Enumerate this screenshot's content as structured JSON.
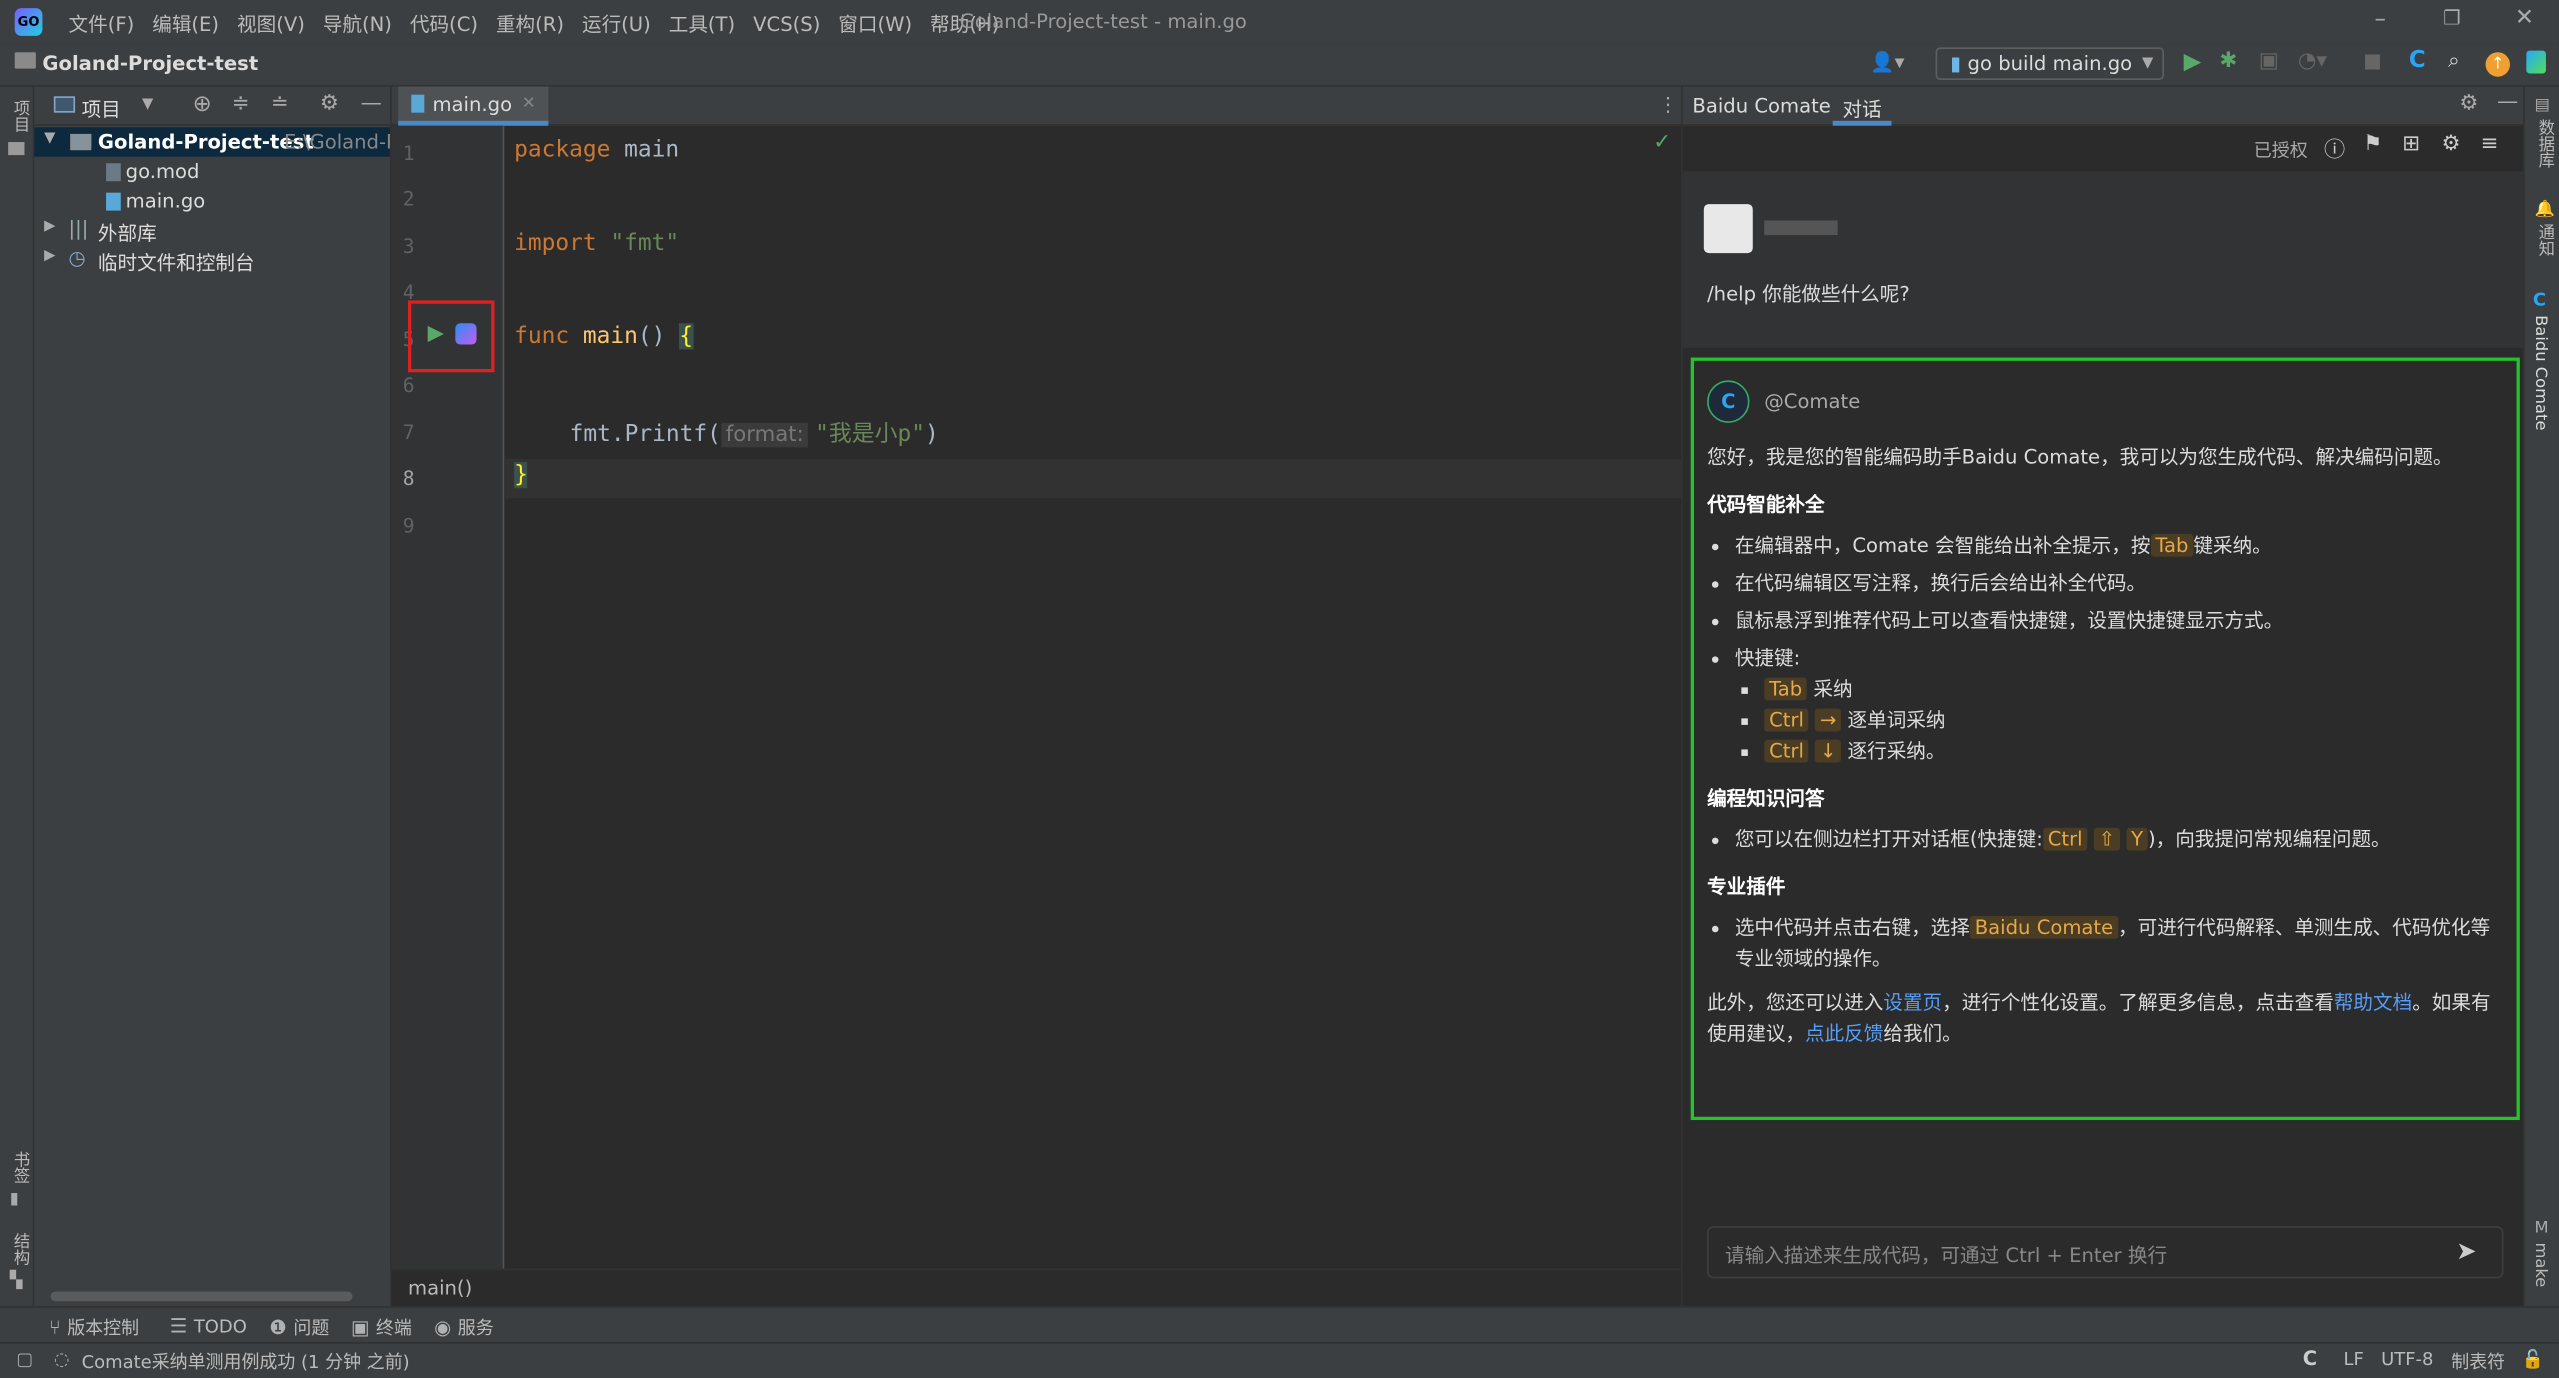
{
  "title_bar": {
    "menus": [
      "文件(F)",
      "编辑(E)",
      "视图(V)",
      "导航(N)",
      "代码(C)",
      "重构(R)",
      "运行(U)",
      "工具(T)",
      "VCS(S)",
      "窗口(W)",
      "帮助(H)"
    ],
    "window_title": "Goland-Project-test - main.go"
  },
  "nav_bar": {
    "project_name": "Goland-Project-test",
    "run_config": "go build main.go"
  },
  "left_strip": {
    "project_label": "项目",
    "bookmarks_label": "书签",
    "structure_label": "结构"
  },
  "right_strip": {
    "database_label": "数据库",
    "notifications_label": "通知",
    "comate_label": "Baidu Comate",
    "make_label": "make"
  },
  "project_panel": {
    "header_label": "项目",
    "root_name": "Goland-Project-test",
    "root_path": "E:\\Goland-Pr",
    "files": [
      "go.mod",
      "main.go"
    ],
    "external_libs": "外部库",
    "scratches": "临时文件和控制台"
  },
  "editor": {
    "tab_name": "main.go",
    "line_numbers": [
      "1",
      "2",
      "3",
      "4",
      "5",
      "6",
      "7",
      "8",
      "9"
    ],
    "code": {
      "l1_kw": "package",
      "l1_name": " main",
      "l3_kw": "import",
      "l3_str": " \"fmt\"",
      "l5_kw": "func",
      "l5_fn": " main",
      "l5_rest": "() ",
      "l5_brace": "{",
      "l7_call": "fmt.Printf(",
      "l7_hint": "format:",
      "l7_str": "\"我是小p\"",
      "l7_close": ")",
      "l8_brace": "}"
    },
    "breadcrumb": "main()"
  },
  "comate": {
    "tab_plugin": "Baidu Comate",
    "tab_chat": "对话",
    "authorized": "已授权",
    "user_message": "/help 你能做些什么呢?",
    "bot_name": "@Comate",
    "intro": "您好，我是您的智能编码助手Baidu Comate，我可以为您生成代码、解决编码问题。",
    "section1_title": "代码智能补全",
    "s1_item1_pre": "在编辑器中，Comate 会智能给出补全提示，按",
    "s1_item1_key": "Tab",
    "s1_item1_post": "键采纳。",
    "s1_item2": "在代码编辑区写注释，换行后会给出补全代码。",
    "s1_item3": "鼠标悬浮到推荐代码上可以查看快捷键，设置快捷键显示方式。",
    "s1_item4": "快捷键:",
    "shortcut1_key": "Tab",
    "shortcut1_text": "采纳",
    "shortcut2_key1": "Ctrl",
    "shortcut2_key2": "→",
    "shortcut2_text": "逐单词采纳",
    "shortcut3_key1": "Ctrl",
    "shortcut3_key2": "↓",
    "shortcut3_text": "逐行采纳。",
    "section2_title": "编程知识问答",
    "s2_item1_pre": "您可以在侧边栏打开对话框(快捷键:",
    "s2_key1": "Ctrl",
    "s2_key2": "⇧",
    "s2_key3": "Y",
    "s2_item1_post": ")，向我提问常规编程问题。",
    "section3_title": "专业插件",
    "s3_item1_pre": "选中代码并点击右键，选择",
    "s3_item1_key": "Baidu Comate",
    "s3_item1_post": "，可进行代码解释、单测生成、代码优化等专业领域的操作。",
    "footer_pre": "此外，您还可以进入",
    "footer_link1": "设置页",
    "footer_mid1": "，进行个性化设置。了解更多信息，点击查看",
    "footer_link2": "帮助文档",
    "footer_mid2": "。如果有使用建议，",
    "footer_link3": "点此反馈",
    "footer_post": "给我们。",
    "input_placeholder": "请输入描述来生成代码，可通过 Ctrl + Enter 换行"
  },
  "bottom_tools": [
    "版本控制",
    "TODO",
    "问题",
    "终端",
    "服务"
  ],
  "status_bar": {
    "message": "Comate采纳单测用例成功 (1 分钟 之前)",
    "line_sep": "LF",
    "encoding": "UTF-8",
    "indent": "制表符"
  },
  "colors": {
    "highlight_box": "#e02020",
    "answer_border": "#25c42a",
    "accent": "#589df6"
  }
}
